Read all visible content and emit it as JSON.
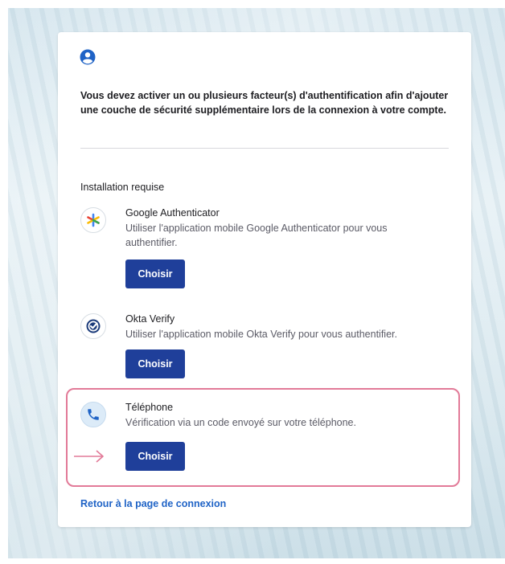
{
  "title": "Vous devez activer un ou plusieurs facteur(s) d'authentification afin d'ajouter une couche de sécurité supplémentaire lors de la connexion à votre compte.",
  "section_label": "Installation requise",
  "factors": [
    {
      "name": "Google Authenticator",
      "description": "Utiliser l'application mobile Google Authenticator pour vous authentifier.",
      "button_label": "Choisir",
      "icon": "google-authenticator-icon"
    },
    {
      "name": "Okta Verify",
      "description": "Utiliser l'application mobile Okta Verify pour vous authentifier.",
      "button_label": "Choisir",
      "icon": "okta-verify-icon"
    },
    {
      "name": "Téléphone",
      "description": "Vérification via un code envoyé sur votre téléphone.",
      "button_label": "Choisir",
      "icon": "phone-icon"
    }
  ],
  "back_link": "Retour à la page de connexion",
  "colors": {
    "button": "#1f3f9a",
    "link": "#1f63c6",
    "highlight": "#e27a98",
    "accent_icon": "#1f63c6"
  }
}
